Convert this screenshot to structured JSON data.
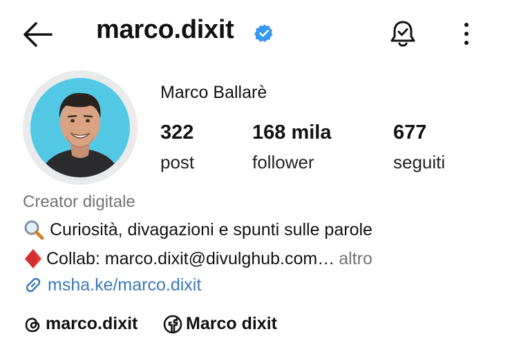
{
  "header": {
    "username": "marco.dixit",
    "back_icon": "arrow-left-icon",
    "verified_icon": "verified-badge-icon",
    "notification_icon": "bell-check-icon",
    "menu_icon": "vertical-dots-icon",
    "verified_color": "#3897f0"
  },
  "profile": {
    "full_name": "Marco Ballarè",
    "avatar_bg_color": "#53c8e4",
    "stats": [
      {
        "value": "322",
        "label": "post"
      },
      {
        "value": "168 mila",
        "label": "follower"
      },
      {
        "value": "677",
        "label": "seguiti"
      }
    ],
    "category": "Creator digitale",
    "bio": {
      "line1_icon": "magnifier-emoji",
      "line1_text": "Curiosità, divagazioni e spunti sulle parole",
      "line2_icon": "red-diamond-emoji",
      "line2_text": "Collab:  marco.dixit@divulghub.com…",
      "more_label": "altro"
    },
    "link": {
      "icon": "link-icon",
      "text": "msha.ke/marco.dixit",
      "color": "#3a79b7"
    },
    "socials": [
      {
        "icon": "threads-icon",
        "label": "marco.dixit"
      },
      {
        "icon": "facebook-icon",
        "label": "Marco dixit"
      }
    ]
  }
}
